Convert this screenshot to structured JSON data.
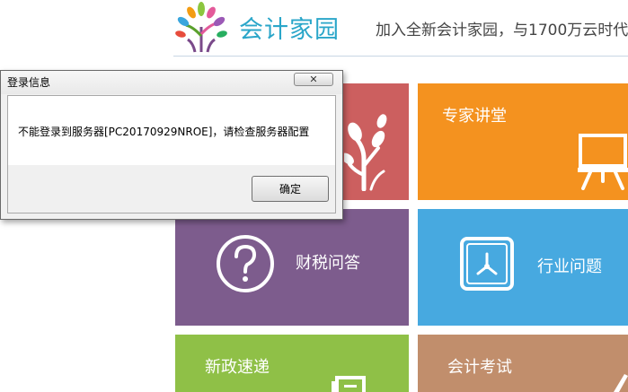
{
  "header": {
    "brand_name": "会计家园",
    "slogan": "加入全新会计家园，与1700万云时代"
  },
  "tiles": [
    {
      "label": ""
    },
    {
      "label": "专家讲堂"
    },
    {
      "label": "财税问答"
    },
    {
      "label": "行业问题"
    },
    {
      "label": "新政速递"
    },
    {
      "label": "会计考试"
    }
  ],
  "dialog": {
    "title": "登录信息",
    "close_glyph": "✕",
    "message": "不能登录到服务器[PC20170929NROE]，请检查服务器配置",
    "ok_label": "确定"
  },
  "colors": {
    "brand": "#2aa6c9",
    "tile_red": "#cc5f5f",
    "tile_orange": "#f4921f",
    "tile_purple": "#7d5c8d",
    "tile_blue": "#47a9e0",
    "tile_green": "#8fc047",
    "tile_brown": "#c18e6c"
  }
}
